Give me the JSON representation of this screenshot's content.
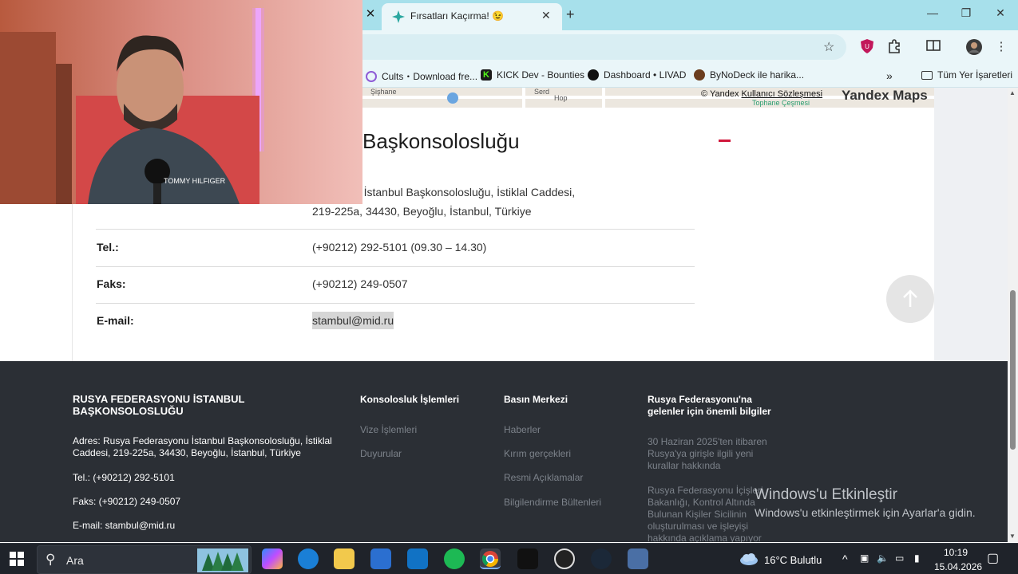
{
  "browser": {
    "active_tab_title": "Fırsatları Kaçırma! 😉",
    "bookmarks": [
      {
        "label": "Cults・Download fre...",
        "color": "#8e5bd6"
      },
      {
        "label": "KICK Dev - Bounties",
        "color": "#1a1a1a"
      },
      {
        "label": "Dashboard • LIVAD",
        "color": "#111111"
      },
      {
        "label": "ByNoDeck ile harika...",
        "color": "#6b3d1e"
      }
    ],
    "all_bookmarks_label": "Tüm Yer İşaretleri",
    "more_bookmarks": "»"
  },
  "map": {
    "credit_prefix": "© Yandex",
    "credit_link": "Kullanıcı Sözleşmesi",
    "brand": "Yandex Maps",
    "street_labels": [
      "Şişhane",
      "Serd",
      "Hop"
    ],
    "place_label": "Tophane Çeşmesi"
  },
  "consulate": {
    "heading": "Başkonsolosluğu",
    "address_line1": "lerasyonu İstanbul Başkonsolosluğu, İstiklal Caddesi,",
    "address_line2": "219-225a, 34430, Beyoğlu, İstanbul, Türkiye",
    "rows": [
      {
        "label": "Tel.:",
        "value": "(+90212) 292-5101 (09.30 – 14.30)"
      },
      {
        "label": "Faks:",
        "value": "(+90212) 249-0507"
      },
      {
        "label": "E-mail:",
        "value": "stambul@mid.ru"
      }
    ]
  },
  "footer": {
    "title": "RUSYA FEDERASYONU İSTANBUL BAŞKONSOLOSLUĞU",
    "address": "Adres: Rusya Federasyonu İstanbul Başkonsolosluğu, İstiklal Caddesi, 219-225a, 34430, Beyoğlu, İstanbul, Türkiye",
    "tel": "Tel.: (+90212) 292-5101",
    "fax": "Faks: (+90212) 249-0507",
    "email": "E-mail: stambul@mid.ru",
    "col1_heading": "Konsolosluk İşlemleri",
    "col1_links": [
      "Vize İşlemleri",
      "Duyurular"
    ],
    "col2_heading": "Basın Merkezi",
    "col2_links": [
      "Haberler",
      "Kırım gerçekleri",
      "Resmi Açıklamalar",
      "Bilgilendirme Bültenleri"
    ],
    "col3_heading": "Rusya Federasyonu'na gelenler için önemli bilgiler",
    "col3_links": [
      "30 Haziran 2025'ten itibaren Rusya'ya girişle ilgili yeni kurallar hakkında",
      "Rusya Federasyonu İçişleri Bakanlığı, Kontrol Altında Bulunan Kişiler Sicilinin oluşturulması ve işleyişi hakkında açıklama yapıyor"
    ]
  },
  "windows_watermark": {
    "line1": "Windows'u Etkinleştir",
    "line2": "Windows'u etkinleştirmek için Ayarlar'a gidin."
  },
  "taskbar": {
    "search_label": "Ara",
    "weather": "16°C Bulutlu",
    "time": "10:19",
    "date": "15.04.2026"
  },
  "webcam": {
    "shirt_text": "TOMMY HILFIGER"
  },
  "colors": {
    "tabbar": "#a7e0eb",
    "footer_bg": "#2b2f35",
    "accent_red": "#d0173b"
  }
}
